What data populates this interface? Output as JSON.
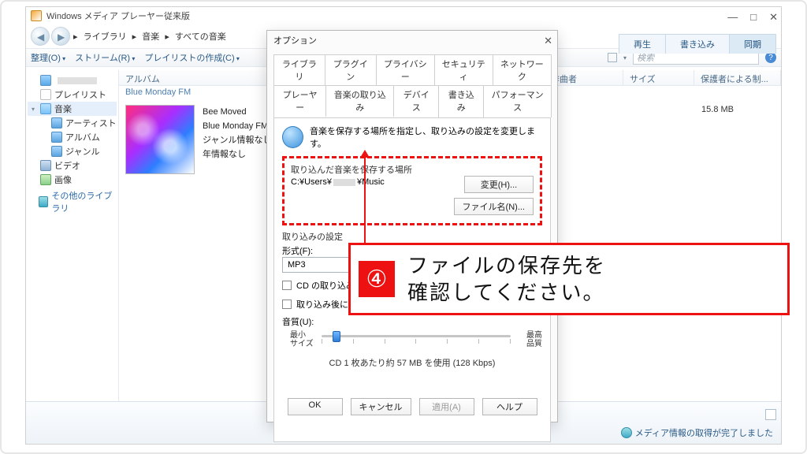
{
  "window": {
    "title": "Windows メディア プレーヤー従来版",
    "min": "—",
    "max": "□",
    "close": "✕"
  },
  "breadcrumb": {
    "sep": "▸",
    "a": "ライブラリ",
    "b": "音楽",
    "c": "すべての音楽"
  },
  "headtabs": {
    "play": "再生",
    "burn": "書き込み",
    "sync": "同期"
  },
  "toolbar": {
    "organize": "整理(O)",
    "stream": "ストリーム(R)",
    "createpl": "プレイリストの作成(C)",
    "search_placeholder": "検索"
  },
  "columns": {
    "album": "アルバム",
    "composer": "作曲者",
    "size": "サイズ",
    "parental": "保護者による制..."
  },
  "tree": {
    "playlists": "プレイリスト",
    "music": "音楽",
    "artist": "アーティスト",
    "album": "アルバム",
    "genre": "ジャンル",
    "video": "ビデオ",
    "image": "画像",
    "other": "その他のライブラリ"
  },
  "album": {
    "title": "Blue Monday FM",
    "tracks": [
      "Bee Moved",
      "Blue Monday FM",
      "ジャンル情報なし",
      "年情報なし"
    ],
    "size": "15.8 MB"
  },
  "dialog": {
    "title": "オプション",
    "tabs_row1": [
      "ライブラリ",
      "プラグイン",
      "プライバシー",
      "セキュリティ",
      "ネットワーク"
    ],
    "tabs_row2": [
      "プレーヤー",
      "音楽の取り込み",
      "デバイス",
      "書き込み",
      "パフォーマンス"
    ],
    "intro": "音楽を保存する場所を指定し、取り込みの設定を変更します。",
    "loc_label": "取り込んだ音楽を保存する場所",
    "path_a": "C:¥Users¥",
    "path_b": "¥Music",
    "btn_change": "変更(H)...",
    "btn_filename": "ファイル名(N)...",
    "import_settings": "取り込みの設定",
    "format_label": "形式(F):",
    "format_value": "MP3",
    "cb_auto": "CD の取り込みを自動的に開始する(R)",
    "cb_eject": "取り込み後に CD を取り出す(E)",
    "quality_label": "音質(U):",
    "q_min_a": "最小",
    "q_min_b": "サイズ",
    "q_max_a": "最高",
    "q_max_b": "品質",
    "usage": "CD 1 枚あたり約 57 MB を使用 (128 Kbps)",
    "ok": "OK",
    "cancel": "キャンセル",
    "apply": "適用(A)",
    "help": "ヘルプ"
  },
  "status": {
    "msg": "メディア情報の取得が完了しました"
  },
  "callout": {
    "num": "④",
    "line1": "ファイルの保存先を",
    "line2": "確認してください。"
  },
  "glyph": {
    "prev": "◂◂",
    "next": "▸▸",
    "stop": "■",
    "play": "▶",
    "shuffle": "⇄",
    "repeat": "↻",
    "vol": "🔊"
  }
}
